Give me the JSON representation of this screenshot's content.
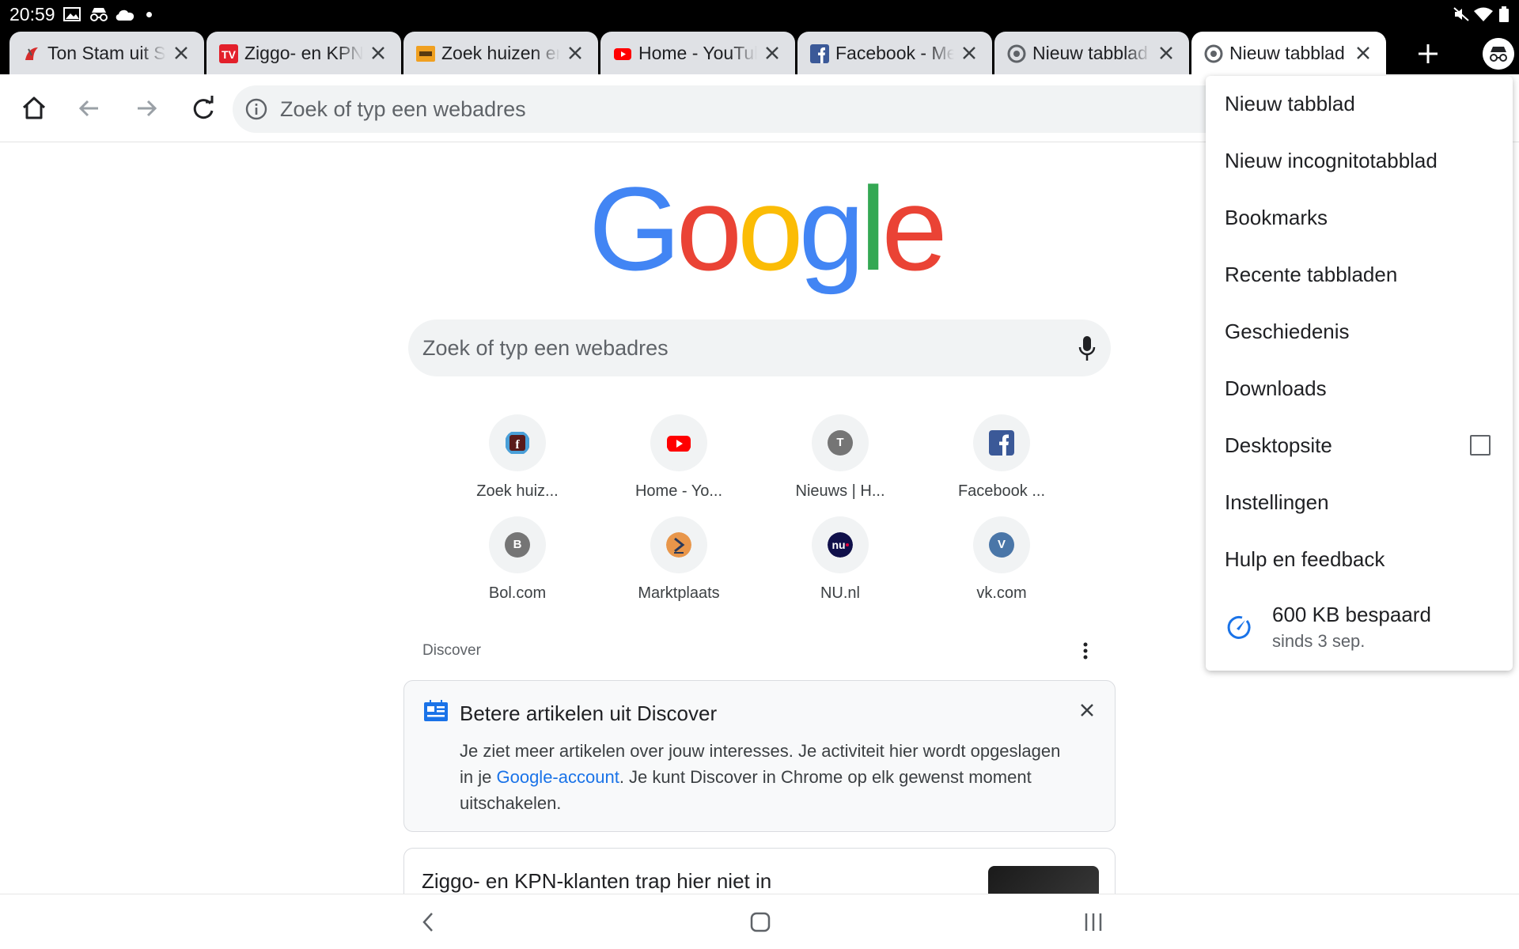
{
  "status_bar": {
    "time": "20:59",
    "icons": [
      "image-icon",
      "incognito-icon",
      "cloud-icon",
      "notification-dot",
      "mute-icon",
      "wifi-icon",
      "battery-icon"
    ]
  },
  "tabs": [
    {
      "title": "Ton Stam uit S",
      "favicon": "site-favicon",
      "active": false
    },
    {
      "title": "Ziggo- en KPN-",
      "favicon": "tv-favicon",
      "active": false
    },
    {
      "title": "Zoek huizen en",
      "favicon": "funda-favicon",
      "active": false
    },
    {
      "title": "Home - YouTub",
      "favicon": "youtube-favicon",
      "active": false
    },
    {
      "title": "Facebook - Mel",
      "favicon": "facebook-favicon",
      "active": false
    },
    {
      "title": "Nieuw tabblad",
      "favicon": "chrome-favicon",
      "active": false
    },
    {
      "title": "Nieuw tabblad",
      "favicon": "chrome-favicon",
      "active": true
    }
  ],
  "toolbar": {
    "omnibox_placeholder": "Zoek of typ een webadres"
  },
  "ntp": {
    "logo_letters": [
      "G",
      "o",
      "o",
      "g",
      "l",
      "e"
    ],
    "logo_colors": [
      "#4285f4",
      "#ea4335",
      "#fbbc05",
      "#4285f4",
      "#34a853",
      "#ea4335"
    ],
    "search_placeholder": "Zoek of typ een webadres",
    "shortcuts": [
      {
        "label": "Zoek huiz...",
        "icon": "funda-icon"
      },
      {
        "label": "Home - Yo...",
        "icon": "youtube-icon"
      },
      {
        "label": "Nieuws | H...",
        "icon_letter": "T",
        "icon_color": "#757575"
      },
      {
        "label": "Facebook ...",
        "icon": "facebook-icon"
      },
      {
        "label": "Bol.com",
        "icon_letter": "B",
        "icon_color": "#757575"
      },
      {
        "label": "Marktplaats",
        "icon": "marktplaats-icon"
      },
      {
        "label": "NU.nl",
        "icon": "nu-icon"
      },
      {
        "label": "vk.com",
        "icon_letter": "V",
        "icon_color": "#4a76a8"
      }
    ]
  },
  "discover": {
    "heading": "Discover",
    "card": {
      "title": "Betere artikelen uit Discover",
      "body_before": "Je ziet meer artikelen over jouw interesses. Je activiteit hier wordt opgeslagen in je ",
      "link": "Google-account",
      "body_after": ". Je kunt Discover in Chrome op elk gewenst moment uitschakelen."
    },
    "article_title": "Ziggo- en KPN-klanten trap hier niet in"
  },
  "menu": {
    "items": [
      "Nieuw tabblad",
      "Nieuw incognitotabblad",
      "Bookmarks",
      "Recente tabbladen",
      "Geschiedenis",
      "Downloads",
      "Desktopsite",
      "Instellingen",
      "Hulp en feedback"
    ],
    "desktop_site_checked": false,
    "data_saver_line1": "600  KB bespaard",
    "data_saver_line2": "sinds 3 sep."
  },
  "colors": {
    "accent": "#1a73e8",
    "tab_inactive": "#dfe1e5",
    "omnibox": "#f1f3f4"
  }
}
